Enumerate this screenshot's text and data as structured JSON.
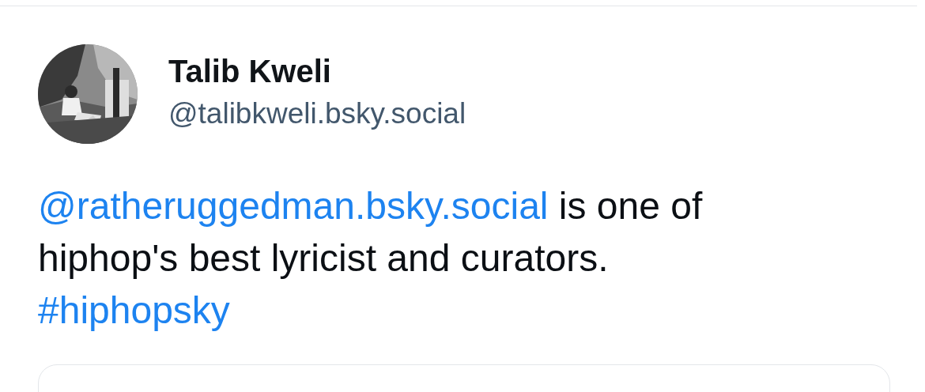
{
  "post": {
    "author": {
      "name": "Talib Kweli",
      "handle": "@talibkweli.bsky.social"
    },
    "text": [
      {
        "kind": "mention",
        "text": "@ratheruggedman.bsky.social"
      },
      {
        "kind": "text",
        "text": " is one of hiphop's best lyricist and curators.\n"
      },
      {
        "kind": "hashtag",
        "text": "#hiphopsky"
      }
    ],
    "embed": {
      "kind": "card"
    }
  }
}
